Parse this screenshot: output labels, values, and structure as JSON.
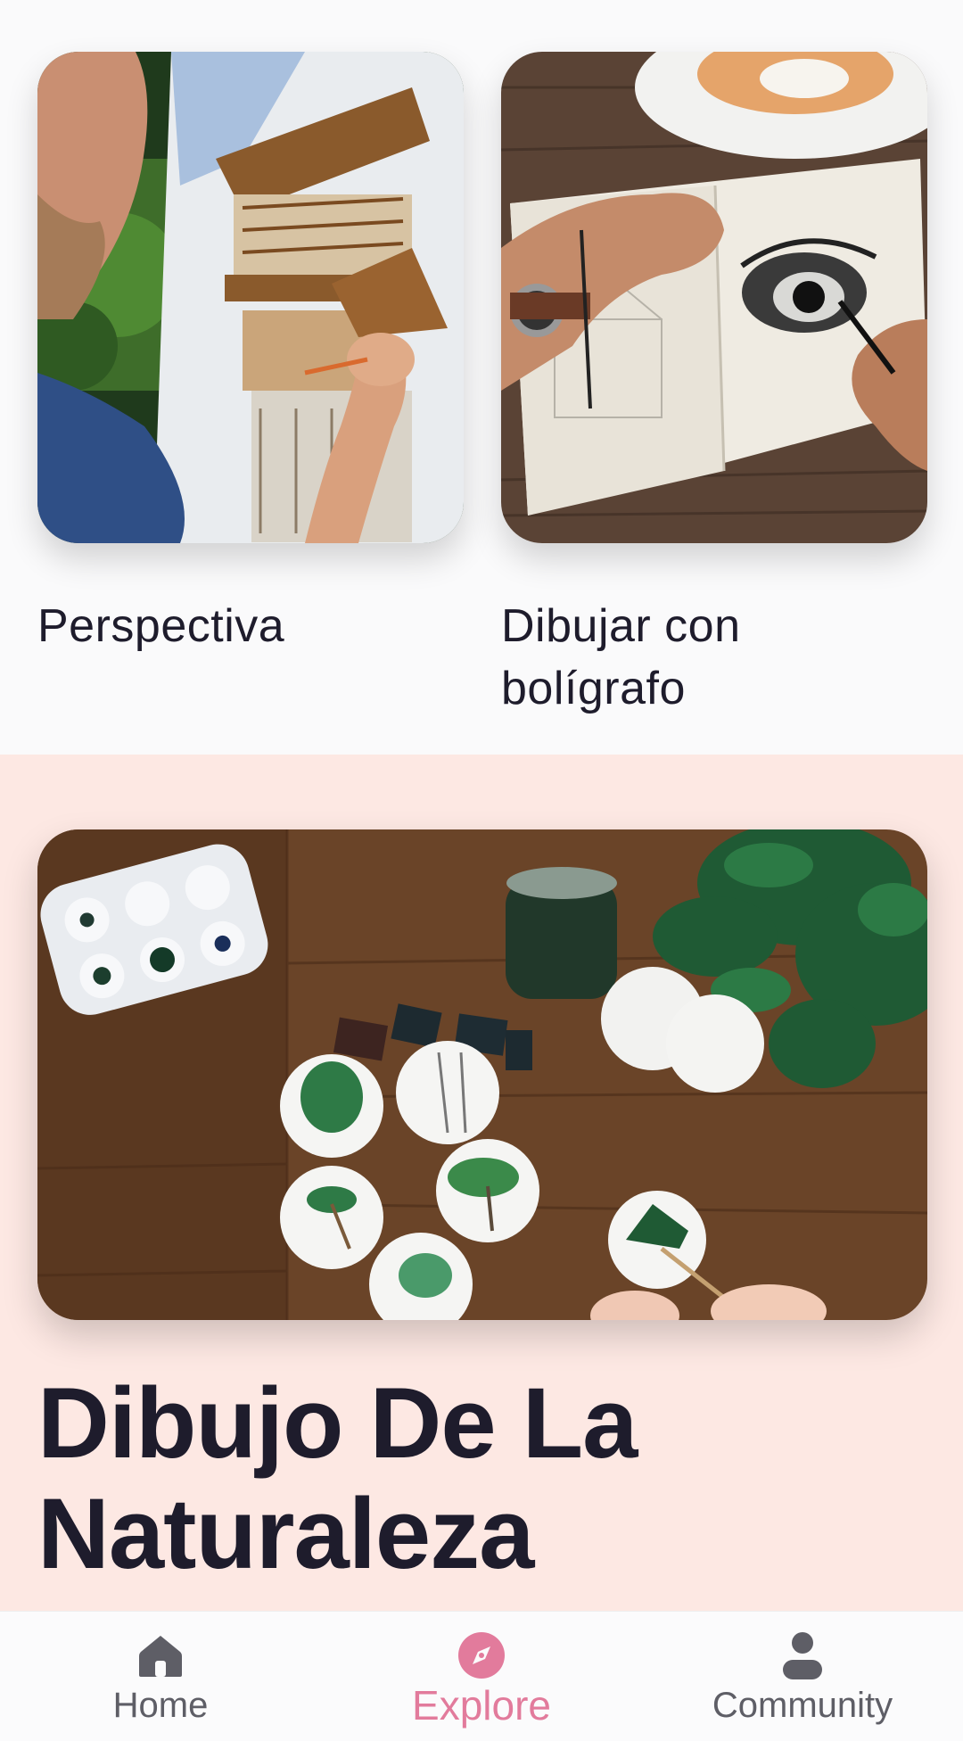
{
  "cards": [
    {
      "title": "Perspectiva",
      "image": "painter-sketching-house-on-canvas"
    },
    {
      "title": "Dibujar con bolígrafo",
      "image": "hands-drawing-eye-in-sketchbook"
    }
  ],
  "featured": {
    "title": "Dibujo De La Naturaleza",
    "image": "watercolor-tree-paintings-on-wooden-table",
    "background_color": "#fde8e3"
  },
  "nav": {
    "items": [
      {
        "label": "Home",
        "icon": "home-icon",
        "active": false
      },
      {
        "label": "Explore",
        "icon": "compass-icon",
        "active": true
      },
      {
        "label": "Community",
        "icon": "person-icon",
        "active": false
      }
    ],
    "active_color": "#e27b9c",
    "inactive_color": "#5e5e66"
  }
}
